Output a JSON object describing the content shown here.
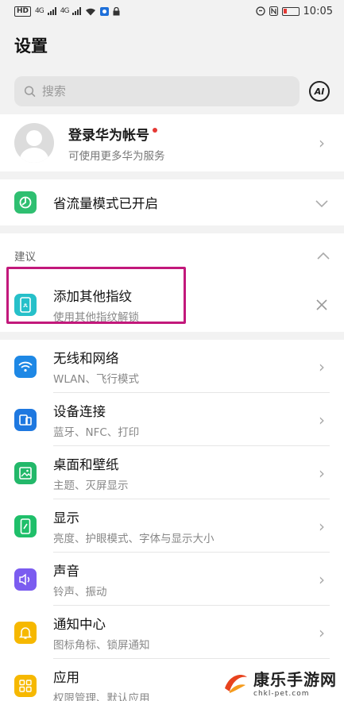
{
  "status_bar": {
    "left_chip": "HD",
    "signal1": "4G",
    "signal2": "4G",
    "time": "10:05"
  },
  "header": {
    "title": "设置"
  },
  "search": {
    "placeholder": "搜索",
    "assist_label": "AI"
  },
  "account": {
    "title": "登录华为帐号",
    "subtitle": "可使用更多华为服务"
  },
  "flow_mode": {
    "title": "省流量模式已开启",
    "icon_color": "#2fbf71"
  },
  "suggestions": {
    "header": "建议",
    "item": {
      "title": "添加其他指纹",
      "subtitle": "使用其他指纹解锁",
      "icon_color": "#26c0c9"
    }
  },
  "settings": [
    {
      "title": "无线和网络",
      "subtitle": "WLAN、飞行模式",
      "icon": "wifi-icon",
      "color": "#1e88e5"
    },
    {
      "title": "设备连接",
      "subtitle": "蓝牙、NFC、打印",
      "icon": "device-connection-icon",
      "color": "#1e78e0"
    },
    {
      "title": "桌面和壁纸",
      "subtitle": "主题、灭屏显示",
      "icon": "wallpaper-icon",
      "color": "#23b86a"
    },
    {
      "title": "显示",
      "subtitle": "亮度、护眼模式、字体与显示大小",
      "icon": "display-icon",
      "color": "#1fbf6a"
    },
    {
      "title": "声音",
      "subtitle": "铃声、振动",
      "icon": "sound-icon",
      "color": "#7b5cf0"
    },
    {
      "title": "通知中心",
      "subtitle": "图标角标、锁屏通知",
      "icon": "bell-icon",
      "color": "#f6b800"
    },
    {
      "title": "应用",
      "subtitle": "权限管理、默认应用",
      "icon": "apps-icon",
      "color": "#f6b800"
    }
  ],
  "watermark": {
    "title": "康乐手游网",
    "url": "chkl-pet.com"
  }
}
